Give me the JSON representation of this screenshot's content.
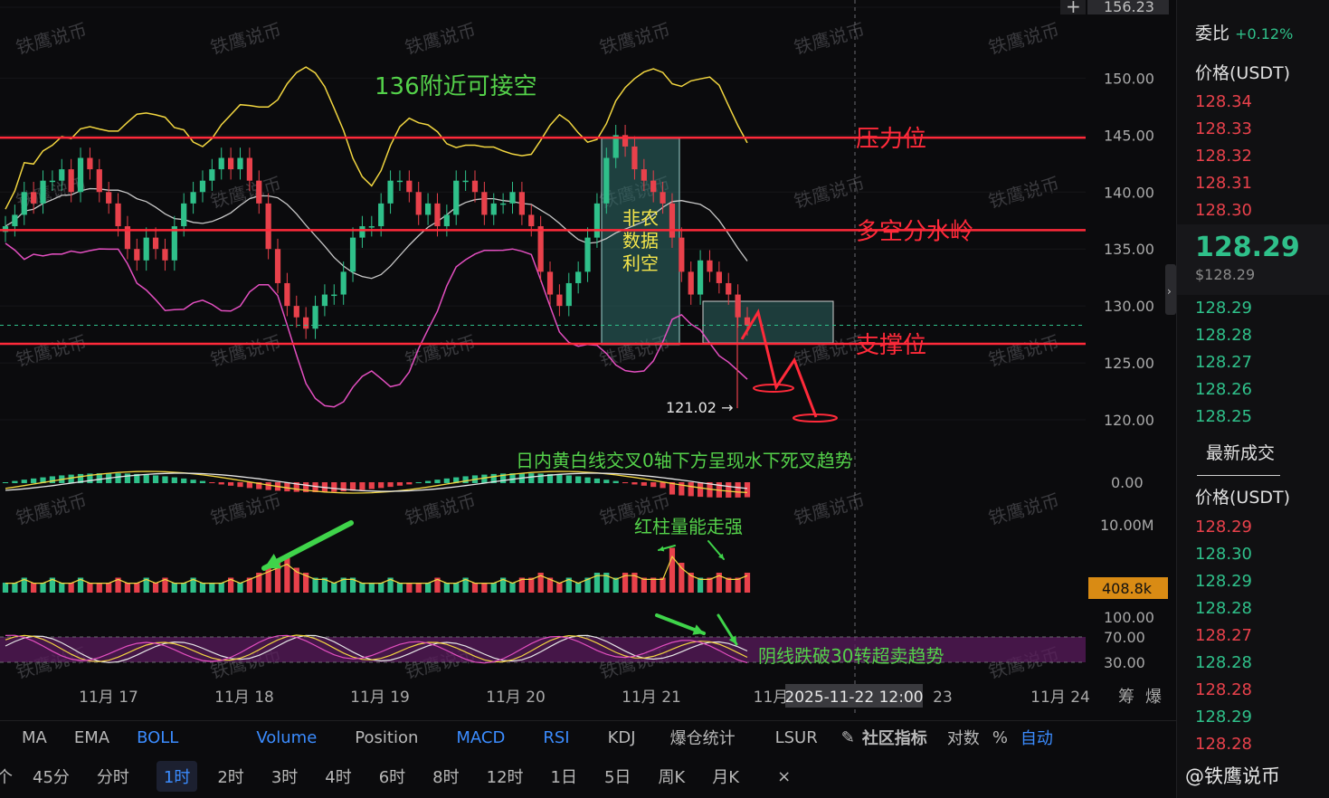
{
  "chart_data": {
    "type": "candlestick",
    "x_ticks": [
      "11月 17",
      "11月 18",
      "11月 19",
      "11月 20",
      "11月 21",
      "11月",
      "23",
      "11月 24"
    ],
    "crosshair_time": "2025-11-22 12:00",
    "y_ticks": [
      "156.23",
      "150.00",
      "145.00",
      "140.00",
      "135.00",
      "130.00",
      "125.00",
      "120.00"
    ],
    "ylim": [
      118,
      156.23
    ],
    "current_price": "128.30",
    "low_label": "121.02 →",
    "levels": [
      {
        "price": 144.78,
        "label": "144.78",
        "name": "压力位"
      },
      {
        "price": 136.66,
        "label": "136.66",
        "name": "多空分水岭"
      },
      {
        "price": 126.67,
        "label": "126.67",
        "name": "支撑位"
      }
    ],
    "close": [
      137,
      138,
      140,
      139,
      141,
      141,
      142,
      140,
      143,
      142,
      140,
      139,
      137,
      135,
      134,
      136,
      135,
      134,
      137,
      139,
      140,
      141,
      142,
      143,
      142,
      143,
      141,
      139,
      135,
      132,
      130,
      129,
      128,
      130,
      131,
      131,
      133,
      136,
      137,
      137,
      139,
      141,
      141,
      140,
      138,
      139,
      137,
      138,
      141,
      141,
      140,
      138,
      139,
      139,
      140,
      138,
      137,
      133,
      131,
      130,
      132,
      133,
      136,
      139,
      143,
      145,
      144,
      142,
      141,
      140,
      139,
      136,
      133,
      131,
      134,
      133,
      132,
      131,
      129,
      128.3
    ],
    "volume": [
      2,
      2,
      3,
      2,
      2,
      3,
      2,
      2,
      3,
      2,
      2,
      2,
      3,
      2,
      2,
      3,
      2,
      3,
      2,
      2,
      3,
      2,
      2,
      2,
      3,
      2,
      3,
      4,
      5,
      6,
      7,
      5,
      4,
      3,
      3,
      2,
      3,
      3,
      2,
      2,
      2,
      3,
      2,
      2,
      2,
      2,
      3,
      2,
      2,
      3,
      2,
      2,
      2,
      3,
      2,
      3,
      3,
      4,
      3,
      2,
      3,
      2,
      3,
      4,
      4,
      3,
      4,
      4,
      3,
      3,
      3,
      9,
      6,
      4,
      3,
      3,
      4,
      3,
      3,
      4
    ],
    "annotations": {
      "title": "136附近可接空",
      "box_label": [
        "非农",
        "数据",
        "利空"
      ],
      "macd_note": "日内黄白线交叉0轴下方呈现水下死叉趋势",
      "vol_note": "红柱量能走强",
      "rsi_note": "阴线跌破30转超卖趋势"
    },
    "macd_axis": "0.00",
    "vol_axis": "10.00M",
    "vol_current": "408.8k",
    "rsi_axis": [
      "100.00",
      "70.00",
      "30.00"
    ],
    "watermark": "铁鹰说币",
    "colors": {
      "up": "#2fc08a",
      "down": "#e8414b",
      "line": "#ff2a3a",
      "upper": "#f2d640",
      "mid": "#c9c9c9",
      "lower": "#e34fc0"
    }
  },
  "order_book": {
    "top_partial": "委比",
    "ratio": "+0.12%",
    "price_header": "价格(USDT)",
    "asks": [
      "128.34",
      "128.33",
      "128.32",
      "128.31",
      "128.30"
    ],
    "last": "128.29",
    "last_usd": "$128.29",
    "bids": [
      "128.29",
      "128.28",
      "128.27",
      "128.26",
      "128.25"
    ],
    "trades_title": "最新成交",
    "trades_header": "价格(USDT)",
    "trades": [
      {
        "p": "128.29",
        "c": "ask"
      },
      {
        "p": "128.30",
        "c": "bid"
      },
      {
        "p": "128.29",
        "c": "bid"
      },
      {
        "p": "128.28",
        "c": "bid"
      },
      {
        "p": "128.27",
        "c": "ask"
      },
      {
        "p": "128.28",
        "c": "bid"
      },
      {
        "p": "128.28",
        "c": "ask"
      },
      {
        "p": "128.29",
        "c": "bid"
      },
      {
        "p": "128.28",
        "c": "ask"
      }
    ]
  },
  "toolbar": {
    "indicators": [
      "MA",
      "EMA",
      "BOLL",
      "Volume",
      "Position",
      "MACD",
      "RSI",
      "KDJ",
      "爆仓统计",
      "LSUR"
    ],
    "active": [
      "BOLL",
      "Volume",
      "MACD",
      "RSI"
    ],
    "community": "社区指标",
    "log": "对数",
    "percent": "%",
    "auto": "自动",
    "intervals": [
      "45分",
      "分时",
      "1时",
      "2时",
      "3时",
      "4时",
      "6时",
      "8时",
      "12时",
      "1日",
      "5日",
      "周K",
      "月K"
    ],
    "active_interval": "1时"
  },
  "brand": "@铁鹰说币"
}
